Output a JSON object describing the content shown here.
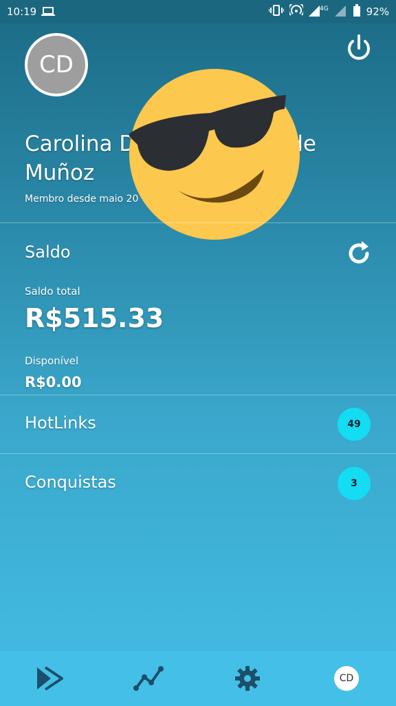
{
  "status_bar": {
    "time": "10:19",
    "network": "4G+",
    "battery": "92%"
  },
  "profile": {
    "initials": "CD",
    "name_line1": "Carolina D",
    "name_line1_tail": "de",
    "name_line2": "Muñoz",
    "member_since": "Membro desde maio 20"
  },
  "balance": {
    "title": "Saldo",
    "total_label": "Saldo total",
    "total_value": "R$515.33",
    "available_label": "Disponível",
    "available_value": "R$0.00"
  },
  "rows": [
    {
      "label": "HotLinks",
      "count": "49"
    },
    {
      "label": "Conquistas",
      "count": "3"
    }
  ],
  "bottom_nav": {
    "avatar_initials": "CD"
  },
  "colors": {
    "badge": "#14dcf2",
    "emoji_yellow": "#fdc84e",
    "background_top": "#1b6a84",
    "background_bottom": "#45bde6"
  },
  "icons": [
    "laptop-icon",
    "vibrate-icon",
    "hotspot-icon",
    "signal-icon",
    "battery-icon",
    "power-icon",
    "refresh-icon",
    "sunglasses-emoji",
    "forward-icon",
    "chart-icon",
    "gear-icon"
  ]
}
